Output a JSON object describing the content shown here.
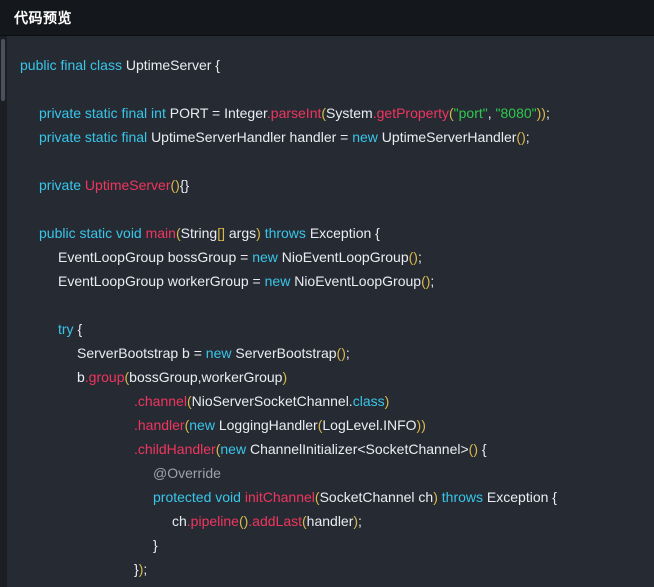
{
  "window": {
    "title": "代码预览"
  },
  "colors": {
    "bar": "#14171b",
    "bg": "#262b33",
    "kw": "#38c6ea",
    "fn": "#f0355f",
    "str": "#2fc94f",
    "pun": "#d9b94a",
    "plain": "#e9ecf2",
    "ann": "#9aa3ad"
  },
  "code": {
    "lines": [
      {
        "indent": 0,
        "tokens": [
          [
            "kw",
            "public final class "
          ],
          [
            "plain",
            "UptimeServer {"
          ]
        ]
      },
      {
        "indent": 0,
        "tokens": []
      },
      {
        "indent": 1,
        "tokens": [
          [
            "kw",
            "private static final int "
          ],
          [
            "plain",
            "PORT = Integer"
          ],
          [
            "fn",
            ".parseInt"
          ],
          [
            "pun",
            "("
          ],
          [
            "plain",
            "System"
          ],
          [
            "fn",
            ".getProperty"
          ],
          [
            "pun",
            "("
          ],
          [
            "str",
            "\"port\""
          ],
          [
            "plain",
            ", "
          ],
          [
            "str",
            "\"8080\""
          ],
          [
            "pun",
            "))"
          ],
          [
            "plain",
            ";"
          ]
        ]
      },
      {
        "indent": 1,
        "tokens": [
          [
            "kw",
            "private static final "
          ],
          [
            "plain",
            "UptimeServerHandler handler = "
          ],
          [
            "kw",
            "new "
          ],
          [
            "plain",
            "UptimeServerHandler"
          ],
          [
            "pun",
            "()"
          ],
          [
            "plain",
            ";"
          ]
        ]
      },
      {
        "indent": 0,
        "tokens": []
      },
      {
        "indent": 1,
        "tokens": [
          [
            "kw",
            "private "
          ],
          [
            "fn",
            "UptimeServer"
          ],
          [
            "pun",
            "()"
          ],
          [
            "plain",
            "{}"
          ]
        ]
      },
      {
        "indent": 0,
        "tokens": []
      },
      {
        "indent": 1,
        "tokens": [
          [
            "kw",
            "public static void "
          ],
          [
            "fn",
            "main"
          ],
          [
            "pun",
            "("
          ],
          [
            "plain",
            "String"
          ],
          [
            "pun",
            "[]"
          ],
          [
            "plain",
            " args"
          ],
          [
            "pun",
            ")"
          ],
          [
            "plain",
            " "
          ],
          [
            "kw",
            "throws "
          ],
          [
            "plain",
            "Exception {"
          ]
        ]
      },
      {
        "indent": 2,
        "tokens": [
          [
            "plain",
            "EventLoopGroup bossGroup = "
          ],
          [
            "kw",
            "new "
          ],
          [
            "plain",
            "NioEventLoopGroup"
          ],
          [
            "pun",
            "()"
          ],
          [
            "plain",
            ";"
          ]
        ]
      },
      {
        "indent": 2,
        "tokens": [
          [
            "plain",
            "EventLoopGroup workerGroup = "
          ],
          [
            "kw",
            "new "
          ],
          [
            "plain",
            "NioEventLoopGroup"
          ],
          [
            "pun",
            "()"
          ],
          [
            "plain",
            ";"
          ]
        ]
      },
      {
        "indent": 0,
        "tokens": []
      },
      {
        "indent": 2,
        "tokens": [
          [
            "kw",
            "try "
          ],
          [
            "plain",
            "{"
          ]
        ]
      },
      {
        "indent": 3,
        "tokens": [
          [
            "plain",
            "ServerBootstrap b = "
          ],
          [
            "kw",
            "new "
          ],
          [
            "plain",
            "ServerBootstrap"
          ],
          [
            "pun",
            "()"
          ],
          [
            "plain",
            ";"
          ]
        ]
      },
      {
        "indent": 3,
        "tokens": [
          [
            "plain",
            "b"
          ],
          [
            "fn",
            ".group"
          ],
          [
            "pun",
            "("
          ],
          [
            "plain",
            "bossGroup,workerGroup"
          ],
          [
            "pun",
            ")"
          ]
        ]
      },
      {
        "indent": 6,
        "tokens": [
          [
            "fn",
            ".channel"
          ],
          [
            "pun",
            "("
          ],
          [
            "plain",
            "NioServerSocketChannel."
          ],
          [
            "kw",
            "class"
          ],
          [
            "pun",
            ")"
          ]
        ]
      },
      {
        "indent": 6,
        "tokens": [
          [
            "fn",
            ".handler"
          ],
          [
            "pun",
            "("
          ],
          [
            "kw",
            "new "
          ],
          [
            "plain",
            "LoggingHandler"
          ],
          [
            "pun",
            "("
          ],
          [
            "plain",
            "LogLevel.INFO"
          ],
          [
            "pun",
            "))"
          ]
        ]
      },
      {
        "indent": 6,
        "tokens": [
          [
            "fn",
            ".childHandler"
          ],
          [
            "pun",
            "("
          ],
          [
            "kw",
            "new "
          ],
          [
            "plain",
            "ChannelInitializer<SocketChannel>"
          ],
          [
            "pun",
            "()"
          ],
          [
            "plain",
            " {"
          ]
        ]
      },
      {
        "indent": 7,
        "tokens": [
          [
            "ann",
            "@Override"
          ]
        ]
      },
      {
        "indent": 7,
        "tokens": [
          [
            "kw",
            "protected void "
          ],
          [
            "fn",
            "initChannel"
          ],
          [
            "pun",
            "("
          ],
          [
            "plain",
            "SocketChannel ch"
          ],
          [
            "pun",
            ")"
          ],
          [
            "plain",
            " "
          ],
          [
            "kw",
            "throws "
          ],
          [
            "plain",
            "Exception {"
          ]
        ]
      },
      {
        "indent": 8,
        "tokens": [
          [
            "plain",
            "ch"
          ],
          [
            "fn",
            ".pipeline"
          ],
          [
            "pun",
            "()"
          ],
          [
            "fn",
            ".addLast"
          ],
          [
            "pun",
            "("
          ],
          [
            "plain",
            "handler"
          ],
          [
            "pun",
            ")"
          ],
          [
            "plain",
            ";"
          ]
        ]
      },
      {
        "indent": 7,
        "tokens": [
          [
            "plain",
            "}"
          ]
        ]
      },
      {
        "indent": 6,
        "tokens": [
          [
            "plain",
            "}"
          ],
          [
            "pun",
            ")"
          ],
          [
            "plain",
            ";"
          ]
        ]
      }
    ]
  }
}
